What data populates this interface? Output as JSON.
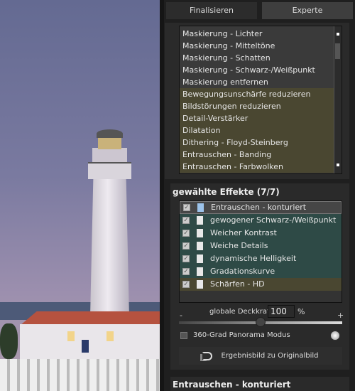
{
  "tabs": {
    "finalize": "Finalisieren",
    "expert": "Experte"
  },
  "effects_library": {
    "items": [
      {
        "label": "Maskierung - Lichter",
        "category": "masking"
      },
      {
        "label": "Maskierung - Mitteltöne",
        "category": "masking"
      },
      {
        "label": "Maskierung - Schatten",
        "category": "masking"
      },
      {
        "label": "Maskierung - Schwarz-/Weißpunkt",
        "category": "masking"
      },
      {
        "label": "Maskierung entfernen",
        "category": "masking"
      },
      {
        "label": "Bewegungsunschärfe reduzieren",
        "category": "filter"
      },
      {
        "label": "Bildstörungen reduzieren",
        "category": "filter"
      },
      {
        "label": "Detail-Verstärker",
        "category": "filter"
      },
      {
        "label": "Dilatation",
        "category": "filter"
      },
      {
        "label": "Dithering - Floyd-Steinberg",
        "category": "filter"
      },
      {
        "label": "Entrauschen - Banding",
        "category": "filter"
      },
      {
        "label": "Entrauschen - Farbwolken",
        "category": "filter"
      }
    ]
  },
  "selected_effects": {
    "title": "gewählte Effekte (7/7)",
    "items": [
      {
        "label": "Entrauschen - konturiert",
        "checked": true,
        "style": "sel"
      },
      {
        "label": "gewogener Schwarz-/Weißpunkt",
        "checked": true,
        "style": "teal"
      },
      {
        "label": "Weicher Kontrast",
        "checked": true,
        "style": "teal"
      },
      {
        "label": "Weiche Details",
        "checked": true,
        "style": "teal"
      },
      {
        "label": "dynamische Helligkeit",
        "checked": true,
        "style": "teal"
      },
      {
        "label": "Gradationskurve",
        "checked": true,
        "style": "teal"
      },
      {
        "label": "Schärfen - HD",
        "checked": true,
        "style": "olive"
      }
    ]
  },
  "opacity": {
    "minus": "-",
    "plus": "+",
    "label": "globale Deckkraft",
    "value": "100",
    "unit": "%",
    "percent": 50
  },
  "panorama": {
    "label": "360-Grad Panorama Modus",
    "checked": false
  },
  "result_button": "Ergebnisbild zu Originalbild",
  "effect_settings_title": "Entrauschen - konturiert",
  "colors": {
    "teal": "#2e4a46",
    "olive": "#4a4731",
    "panel": "#2a2a2a"
  }
}
